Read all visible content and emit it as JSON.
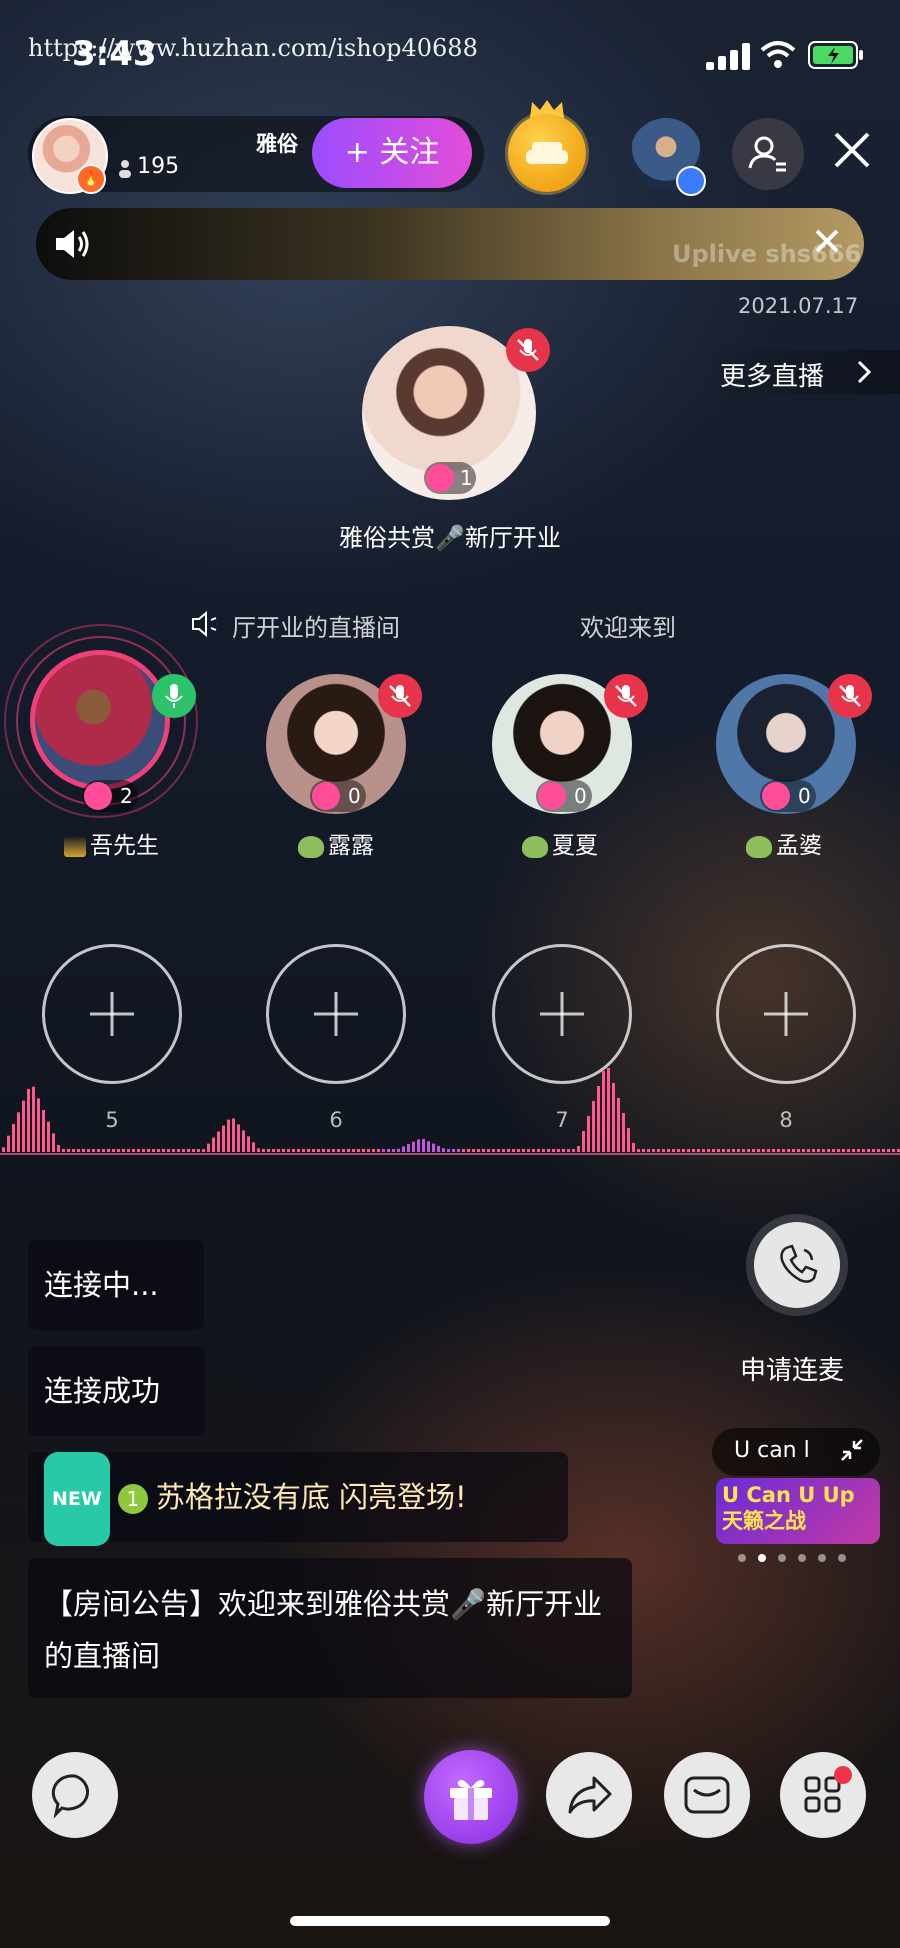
{
  "status_bar": {
    "time": "3:43",
    "watermark": "https://www.huzhan.com/ishop40688"
  },
  "host": {
    "name": "雅俗",
    "viewers": "195",
    "follow_label": "+ 关注"
  },
  "notice": {
    "watermark": "Uplive shs666",
    "date": "2021.07.17"
  },
  "more_live_label": "更多直播",
  "owner": {
    "star_count": "1",
    "room_title": "雅俗共赏🎤新厅开业"
  },
  "marquee": {
    "text": "厅开业的直播间",
    "text2": "欢迎来到"
  },
  "seats": [
    {
      "name": "吾先生",
      "stars": "2",
      "mic": "on"
    },
    {
      "name": "露露",
      "stars": "0",
      "mic": "muted"
    },
    {
      "name": "夏夏",
      "stars": "0",
      "mic": "muted"
    },
    {
      "name": "孟婆",
      "stars": "0",
      "mic": "muted"
    }
  ],
  "empty_seats": [
    "5",
    "6",
    "7",
    "8"
  ],
  "messages": {
    "connecting": "连接中...",
    "connected": "连接成功",
    "new_badge": "NEW",
    "level": "1",
    "entrance": "苏格拉没有底 闪亮登场!",
    "announcement": "【房间公告】欢迎来到雅俗共赏🎤新厅开业的直播间"
  },
  "apply_mic_label": "申请连麦",
  "promo": {
    "text": "U can l",
    "banner": "U Can U Up 天籁之战"
  },
  "colors": {
    "follow": "#9b4dff",
    "mute": "#e8344a",
    "mic_on": "#2bc46a",
    "star": "#ff4d9a",
    "new_badge": "#27c9a6"
  }
}
